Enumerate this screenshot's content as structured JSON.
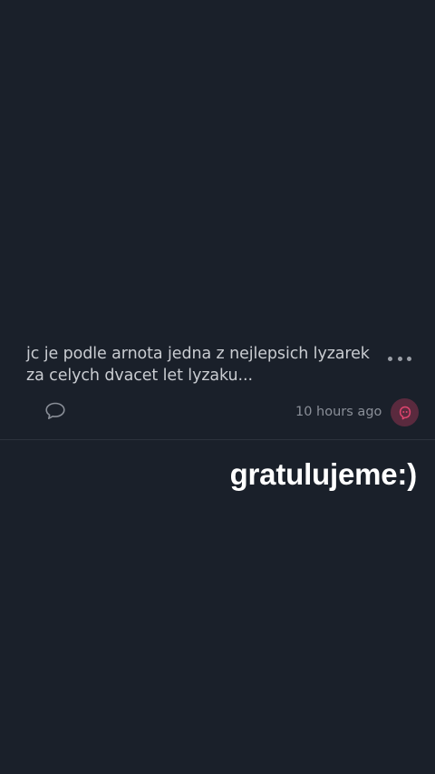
{
  "post": {
    "text": "jc je podle arnota jedna z nejlepsich lyzarek za celych dvacet let lyzaku...",
    "time": "10 hours ago",
    "more_icon": "ellipsis-icon",
    "comment_icon": "speech-bubble-icon",
    "avatar_icon": "ghost-face-icon"
  },
  "overlay": {
    "text": "gratulujeme:)"
  },
  "colors": {
    "background": "#1a202a",
    "text": "#c9ccd1",
    "muted": "#8a8f98",
    "avatar_bg": "#5a2a3e",
    "avatar_accent": "#e0456f"
  }
}
